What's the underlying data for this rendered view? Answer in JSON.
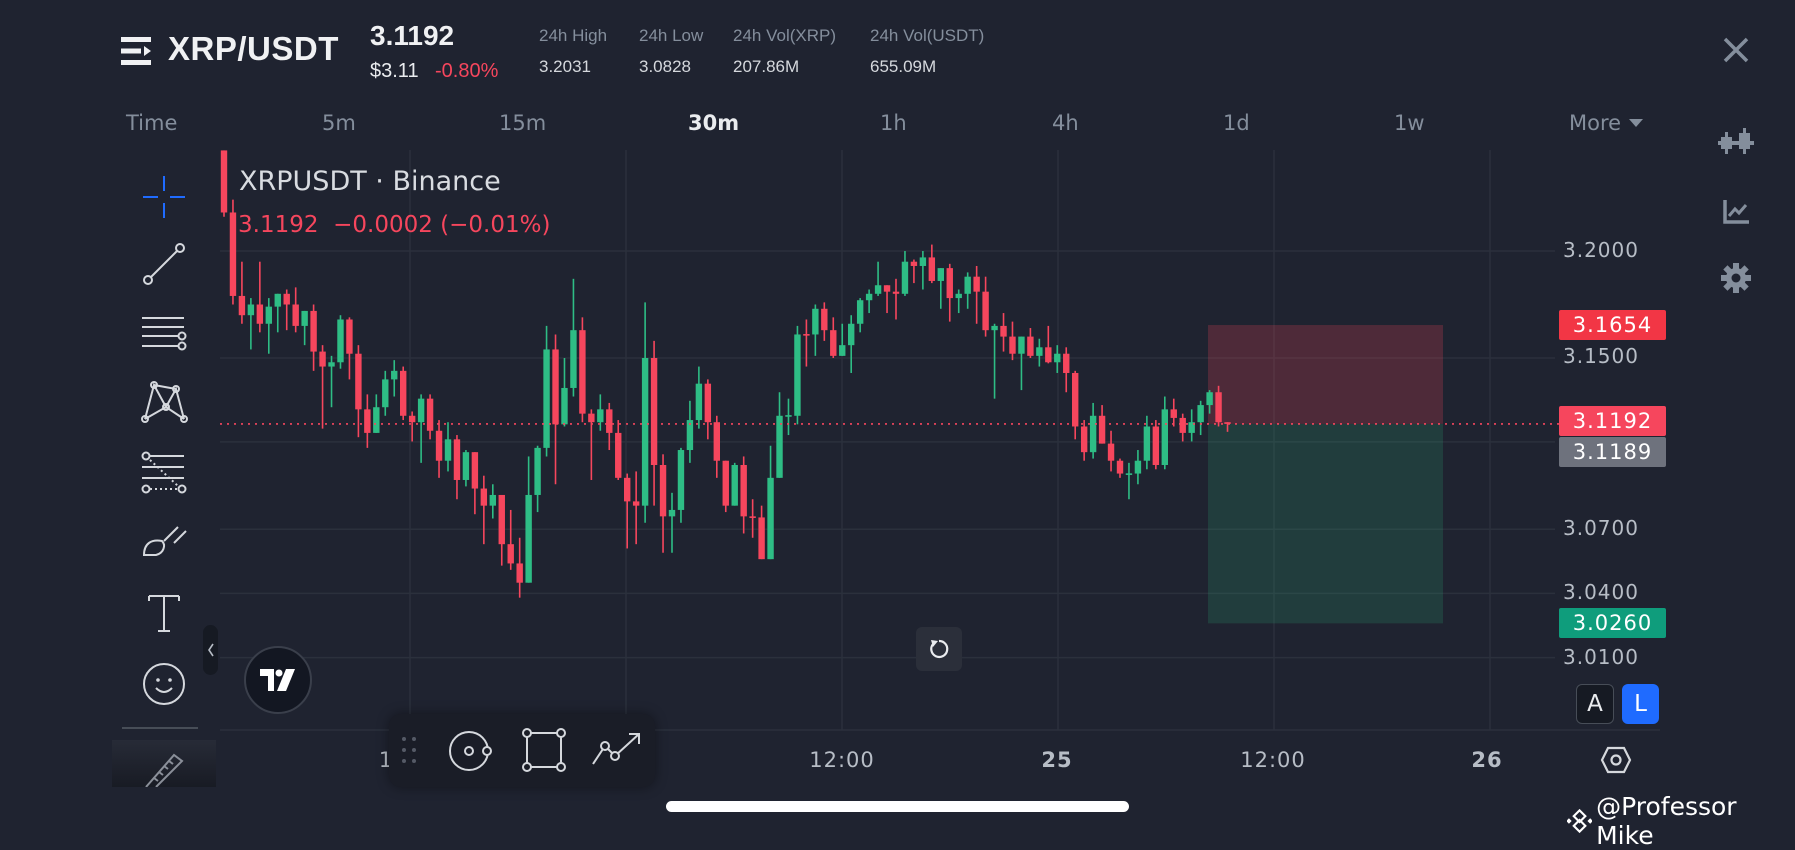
{
  "header": {
    "pair": "XRP/USDT",
    "last_price": "3.1192",
    "usd_price": "$3.11",
    "change_pct": "-0.80%",
    "stats": [
      {
        "label": "24h High",
        "value": "3.2031"
      },
      {
        "label": "24h Low",
        "value": "3.0828"
      },
      {
        "label": "24h Vol(XRP)",
        "value": "207.86M"
      },
      {
        "label": "24h Vol(USDT)",
        "value": "655.09M"
      }
    ]
  },
  "timeframes": {
    "items": [
      "Time",
      "5m",
      "15m",
      "30m",
      "1h",
      "4h",
      "1d",
      "1w"
    ],
    "active": "30m",
    "more_label": "More"
  },
  "legend": {
    "symbol": "XRPUSDT · Binance",
    "price_line": "3.1192  −0.0002 (−0.01%)"
  },
  "price_axis": {
    "labels": [
      "3.2000",
      "3.1500",
      "3.0700",
      "3.0400",
      "3.0100"
    ],
    "badges": {
      "stop": "3.1654",
      "last": "3.1192",
      "mark": "3.1189",
      "target": "3.0260"
    },
    "auto_label": "A",
    "log_label": "L"
  },
  "time_axis": {
    "labels": [
      "1",
      "12:00",
      "25",
      "12:00",
      "26"
    ]
  },
  "colors": {
    "up": "#2ebd85",
    "down": "#f6465d",
    "background": "#1f2330",
    "accent_blue": "#1f6bff",
    "target_green": "#0f9d7c",
    "mark_gray": "#6e727d"
  },
  "watermark": "@Professor Mike",
  "chart_data": {
    "type": "candlestick",
    "symbol": "XRPUSDT",
    "interval": "30m",
    "ylim": [
      3.0,
      3.247
    ],
    "y_ticks": [
      3.2,
      3.15,
      3.07,
      3.04,
      3.01
    ],
    "last_price": 3.1192,
    "position": {
      "side": "short",
      "entry": 3.1192,
      "stop": 3.1654,
      "target": 3.026
    },
    "candles_ohlc": [
      [
        3.247,
        3.247,
        3.216,
        3.218
      ],
      [
        3.218,
        3.224,
        3.175,
        3.179
      ],
      [
        3.179,
        3.195,
        3.166,
        3.17
      ],
      [
        3.17,
        3.178,
        3.154,
        3.175
      ],
      [
        3.175,
        3.195,
        3.162,
        3.166
      ],
      [
        3.166,
        3.178,
        3.152,
        3.174
      ],
      [
        3.174,
        3.18,
        3.162,
        3.18
      ],
      [
        3.18,
        3.182,
        3.163,
        3.175
      ],
      [
        3.175,
        3.183,
        3.162,
        3.165
      ],
      [
        3.165,
        3.172,
        3.156,
        3.172
      ],
      [
        3.172,
        3.175,
        3.144,
        3.153
      ],
      [
        3.153,
        3.156,
        3.117,
        3.146
      ],
      [
        3.146,
        3.151,
        3.127,
        3.148
      ],
      [
        3.148,
        3.17,
        3.145,
        3.168
      ],
      [
        3.168,
        3.169,
        3.14,
        3.152
      ],
      [
        3.152,
        3.156,
        3.113,
        3.126
      ],
      [
        3.126,
        3.133,
        3.108,
        3.115
      ],
      [
        3.115,
        3.133,
        3.115,
        3.127
      ],
      [
        3.127,
        3.144,
        3.123,
        3.14
      ],
      [
        3.14,
        3.149,
        3.132,
        3.144
      ],
      [
        3.144,
        3.146,
        3.121,
        3.123
      ],
      [
        3.123,
        3.125,
        3.111,
        3.12
      ],
      [
        3.12,
        3.133,
        3.101,
        3.131
      ],
      [
        3.131,
        3.133,
        3.112,
        3.116
      ],
      [
        3.116,
        3.121,
        3.094,
        3.102
      ],
      [
        3.102,
        3.12,
        3.097,
        3.112
      ],
      [
        3.112,
        3.114,
        3.084,
        3.093
      ],
      [
        3.093,
        3.107,
        3.09,
        3.106
      ],
      [
        3.106,
        3.106,
        3.077,
        3.089
      ],
      [
        3.089,
        3.095,
        3.063,
        3.081
      ],
      [
        3.081,
        3.091,
        3.075,
        3.086
      ],
      [
        3.086,
        3.086,
        3.053,
        3.063
      ],
      [
        3.063,
        3.079,
        3.051,
        3.054
      ],
      [
        3.054,
        3.066,
        3.038,
        3.045
      ],
      [
        3.045,
        3.104,
        3.045,
        3.086
      ],
      [
        3.086,
        3.109,
        3.078,
        3.108
      ],
      [
        3.108,
        3.165,
        3.104,
        3.154
      ],
      [
        3.154,
        3.161,
        3.091,
        3.119
      ],
      [
        3.119,
        3.15,
        3.118,
        3.136
      ],
      [
        3.136,
        3.187,
        3.132,
        3.163
      ],
      [
        3.163,
        3.169,
        3.12,
        3.124
      ],
      [
        3.124,
        3.126,
        3.093,
        3.12
      ],
      [
        3.12,
        3.133,
        3.116,
        3.126
      ],
      [
        3.126,
        3.129,
        3.107,
        3.115
      ],
      [
        3.115,
        3.121,
        3.093,
        3.094
      ],
      [
        3.094,
        3.096,
        3.061,
        3.083
      ],
      [
        3.083,
        3.097,
        3.063,
        3.081
      ],
      [
        3.081,
        3.176,
        3.073,
        3.15
      ],
      [
        3.15,
        3.158,
        3.081,
        3.1
      ],
      [
        3.1,
        3.105,
        3.059,
        3.076
      ],
      [
        3.076,
        3.087,
        3.059,
        3.079
      ],
      [
        3.079,
        3.108,
        3.073,
        3.107
      ],
      [
        3.107,
        3.13,
        3.101,
        3.121
      ],
      [
        3.121,
        3.146,
        3.117,
        3.138
      ],
      [
        3.138,
        3.14,
        3.112,
        3.12
      ],
      [
        3.12,
        3.123,
        3.094,
        3.102
      ],
      [
        3.102,
        3.102,
        3.078,
        3.081
      ],
      [
        3.081,
        3.101,
        3.081,
        3.1
      ],
      [
        3.1,
        3.104,
        3.068,
        3.076
      ],
      [
        3.076,
        3.084,
        3.066,
        3.0755
      ],
      [
        3.0755,
        3.081,
        3.056,
        3.056
      ],
      [
        3.056,
        3.109,
        3.056,
        3.094
      ],
      [
        3.094,
        3.134,
        3.094,
        3.123
      ],
      [
        3.1226,
        3.131,
        3.114,
        3.1233
      ],
      [
        3.123,
        3.165,
        3.119,
        3.161
      ],
      [
        3.1612,
        3.168,
        3.146,
        3.1608
      ],
      [
        3.161,
        3.175,
        3.151,
        3.173
      ],
      [
        3.173,
        3.176,
        3.158,
        3.163
      ],
      [
        3.163,
        3.169,
        3.15,
        3.151
      ],
      [
        3.151,
        3.166,
        3.151,
        3.156
      ],
      [
        3.156,
        3.17,
        3.143,
        3.166
      ],
      [
        3.166,
        3.178,
        3.162,
        3.177
      ],
      [
        3.177,
        3.182,
        3.171,
        3.18
      ],
      [
        3.18,
        3.195,
        3.179,
        3.184
      ],
      [
        3.184,
        3.184,
        3.171,
        3.181
      ],
      [
        3.181,
        3.187,
        3.168,
        3.18
      ],
      [
        3.18,
        3.2,
        3.179,
        3.195
      ],
      [
        3.195,
        3.196,
        3.185,
        3.193
      ],
      [
        3.193,
        3.2,
        3.182,
        3.197
      ],
      [
        3.197,
        3.203,
        3.185,
        3.186
      ],
      [
        3.186,
        3.192,
        3.173,
        3.192
      ],
      [
        3.192,
        3.194,
        3.167,
        3.178
      ],
      [
        3.178,
        3.182,
        3.171,
        3.18
      ],
      [
        3.18,
        3.19,
        3.173,
        3.188
      ],
      [
        3.188,
        3.193,
        3.166,
        3.181
      ],
      [
        3.181,
        3.188,
        3.16,
        3.163
      ],
      [
        3.163,
        3.166,
        3.131,
        3.165
      ],
      [
        3.165,
        3.171,
        3.153,
        3.16
      ],
      [
        3.16,
        3.167,
        3.149,
        3.152
      ],
      [
        3.152,
        3.16,
        3.135,
        3.16
      ],
      [
        3.16,
        3.164,
        3.15,
        3.151
      ],
      [
        3.151,
        3.159,
        3.146,
        3.155
      ],
      [
        3.155,
        3.165,
        3.1475,
        3.148
      ],
      [
        3.148,
        3.156,
        3.143,
        3.152
      ],
      [
        3.152,
        3.155,
        3.134,
        3.143
      ],
      [
        3.143,
        3.144,
        3.112,
        3.118
      ],
      [
        3.118,
        3.121,
        3.102,
        3.106
      ],
      [
        3.106,
        3.129,
        3.103,
        3.123
      ],
      [
        3.123,
        3.128,
        3.11,
        3.11
      ],
      [
        3.11,
        3.116,
        3.097,
        3.102
      ],
      [
        3.102,
        3.103,
        3.094,
        3.096
      ],
      [
        3.096,
        3.101,
        3.084,
        3.0961
      ],
      [
        3.096,
        3.107,
        3.091,
        3.102
      ],
      [
        3.102,
        3.123,
        3.098,
        3.118
      ],
      [
        3.118,
        3.121,
        3.098,
        3.1
      ],
      [
        3.1,
        3.132,
        3.098,
        3.126
      ],
      [
        3.126,
        3.131,
        3.118,
        3.122
      ],
      [
        3.122,
        3.124,
        3.111,
        3.115
      ],
      [
        3.115,
        3.126,
        3.111,
        3.12
      ],
      [
        3.12,
        3.13,
        3.114,
        3.128
      ],
      [
        3.128,
        3.135,
        3.124,
        3.134
      ],
      [
        3.134,
        3.137,
        3.118,
        3.12
      ],
      [
        3.12,
        3.12,
        3.1155,
        3.1192
      ]
    ]
  }
}
